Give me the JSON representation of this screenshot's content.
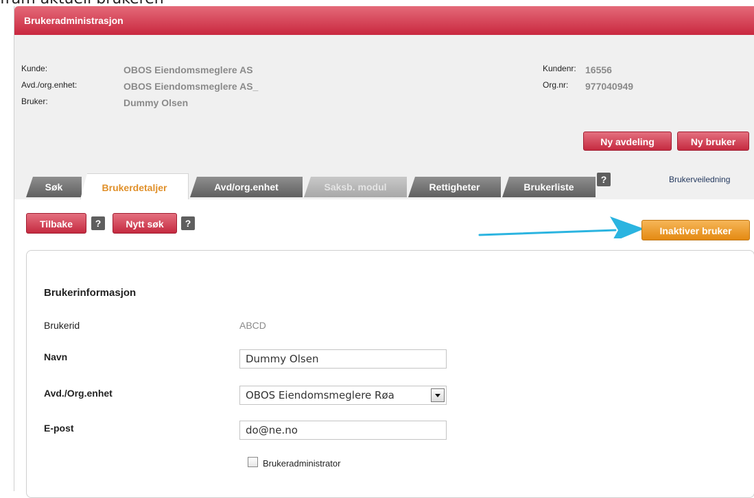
{
  "caption": "fram aktuell brukeren",
  "window": {
    "title": "Brukeradministrasjon"
  },
  "info": {
    "kunde_label": "Kunde:",
    "kunde_value": "OBOS Eiendomsmeglere AS",
    "avd_label": "Avd./org.enhet:",
    "avd_value": "OBOS Eiendomsmeglere AS_",
    "bruker_label": "Bruker:",
    "bruker_value": "Dummy Olsen",
    "kundenr_label": "Kundenr:",
    "kundenr_value": "16556",
    "orgnr_label": "Org.nr:",
    "orgnr_value": "977040949"
  },
  "actions": {
    "ny_avdeling": "Ny avdeling",
    "ny_bruker": "Ny bruker"
  },
  "tabs": [
    {
      "label": "Søk",
      "state": "normal"
    },
    {
      "label": "Brukerdetaljer",
      "state": "active"
    },
    {
      "label": "Avd/org.enhet",
      "state": "normal"
    },
    {
      "label": "Saksb. modul",
      "state": "disabled"
    },
    {
      "label": "Rettigheter",
      "state": "normal"
    },
    {
      "label": "Brukerliste",
      "state": "normal"
    }
  ],
  "help_glyph": "?",
  "guide_link": "Brukerveiledning",
  "toolbar": {
    "tilbake": "Tilbake",
    "nytt_sok": "Nytt søk",
    "inaktiver": "Inaktiver bruker"
  },
  "form": {
    "section_title": "Brukerinformasjon",
    "brukerid_label": "Brukerid",
    "brukerid_value": "ABCD",
    "navn_label": "Navn",
    "navn_value": "Dummy Olsen",
    "avd_label": "Avd./Org.enhet",
    "avd_value": "OBOS Eiendomsmeglere Røa",
    "epost_label": "E-post",
    "epost_value": "do@ne.no",
    "admin_label": "Brukeradministrator",
    "admin_checked": false
  },
  "colors": {
    "brand_red": "#c9283f",
    "action_orange": "#e48a12",
    "tab_active_text": "#e0902a",
    "arrow": "#2bb4e0"
  }
}
